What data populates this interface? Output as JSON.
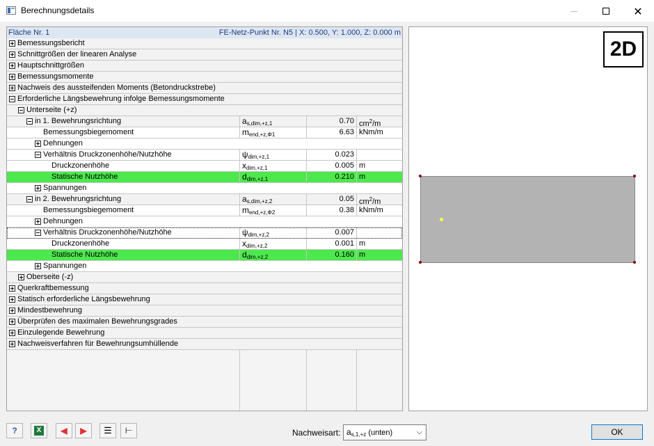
{
  "window": {
    "title": "Berechnungsdetails",
    "close_glyph": "✕"
  },
  "header": {
    "left": "Fläche Nr. 1",
    "right": "FE-Netz-Punkt Nr. N5  |  X: 0.500, Y: 1.000, Z: 0.000 m"
  },
  "tree": {
    "r0": "Bemessungsbericht",
    "r1": "Schnittgrößen der linearen Analyse",
    "r2": "Hauptschnittgrößen",
    "r3": "Bemessungsmomente",
    "r4": "Nachweis des aussteifenden Moments (Betondruckstrebe)",
    "r5": "Erforderliche Längsbewehrung infolge Bemessungsmomente",
    "r6": "Unterseite (+z)",
    "r7": {
      "name": "in 1. Bewehrungsrichtung",
      "sym": "a",
      "sub": "s,dim,+z,1",
      "val": "0.70",
      "unit": "cm",
      "unit_sup": "2",
      "unit_tail": "/m"
    },
    "r8": {
      "name": "Bemessungsbiegemoment",
      "sym": "m",
      "sub": "end,+z,Φ1",
      "val": "6.63",
      "unit": "kNm/m"
    },
    "r9": "Dehnungen",
    "r10": {
      "name": "Verhältnis Druckzonenhöhe/Nutzhöhe",
      "sym": "ψ",
      "sub": "dim,+z,1",
      "val": "0.023",
      "unit": ""
    },
    "r11": {
      "name": "Druckzonenhöhe",
      "sym": "x",
      "sub": "dim,+z,1",
      "val": "0.005",
      "unit": "m"
    },
    "r12": {
      "name": "Statische Nutzhöhe",
      "sym": "d",
      "sub": "dim,+z,1",
      "val": "0.210",
      "unit": "m"
    },
    "r13": "Spannungen",
    "r14": {
      "name": "in 2. Bewehrungsrichtung",
      "sym": "a",
      "sub": "s,dim,+z,2",
      "val": "0.05",
      "unit": "cm",
      "unit_sup": "2",
      "unit_tail": "/m"
    },
    "r15": {
      "name": "Bemessungsbiegemoment",
      "sym": "m",
      "sub": "end,+z,Φ2",
      "val": "0.38",
      "unit": "kNm/m"
    },
    "r16": "Dehnungen",
    "r17": {
      "name": "Verhältnis Druckzonenhöhe/Nutzhöhe",
      "sym": "ψ",
      "sub": "dim,+z,2",
      "val": "0.007",
      "unit": ""
    },
    "r18": {
      "name": "Druckzonenhöhe",
      "sym": "x",
      "sub": "dim,+z,2",
      "val": "0.001",
      "unit": "m"
    },
    "r19": {
      "name": "Statische Nutzhöhe",
      "sym": "d",
      "sub": "dim,+z,2",
      "val": "0.160",
      "unit": "m"
    },
    "r20": "Spannungen",
    "r21": "Oberseite (-z)",
    "r22": "Querkraftbemessung",
    "r23": "Statisch erforderliche Längsbewehrung",
    "r24": "Mindestbewehrung",
    "r25": "Überprüfen des maximalen Bewehrungsgrades",
    "r26": "Einzulegende Bewehrung",
    "r27": "Nachweisverfahren für Bewehrungsumhüllende"
  },
  "graphic": {
    "badge": "2D",
    "rect_color": "#b3b3b3",
    "point_color": "#ffff4a",
    "corner_color": "#8b0000"
  },
  "footer": {
    "nachweis_label": "Nachweisart:",
    "select_sym": "a",
    "select_sub": "s,1,+z",
    "select_tail": " (unten)",
    "ok_label": "OK",
    "highlight_color": "#4de84d"
  }
}
